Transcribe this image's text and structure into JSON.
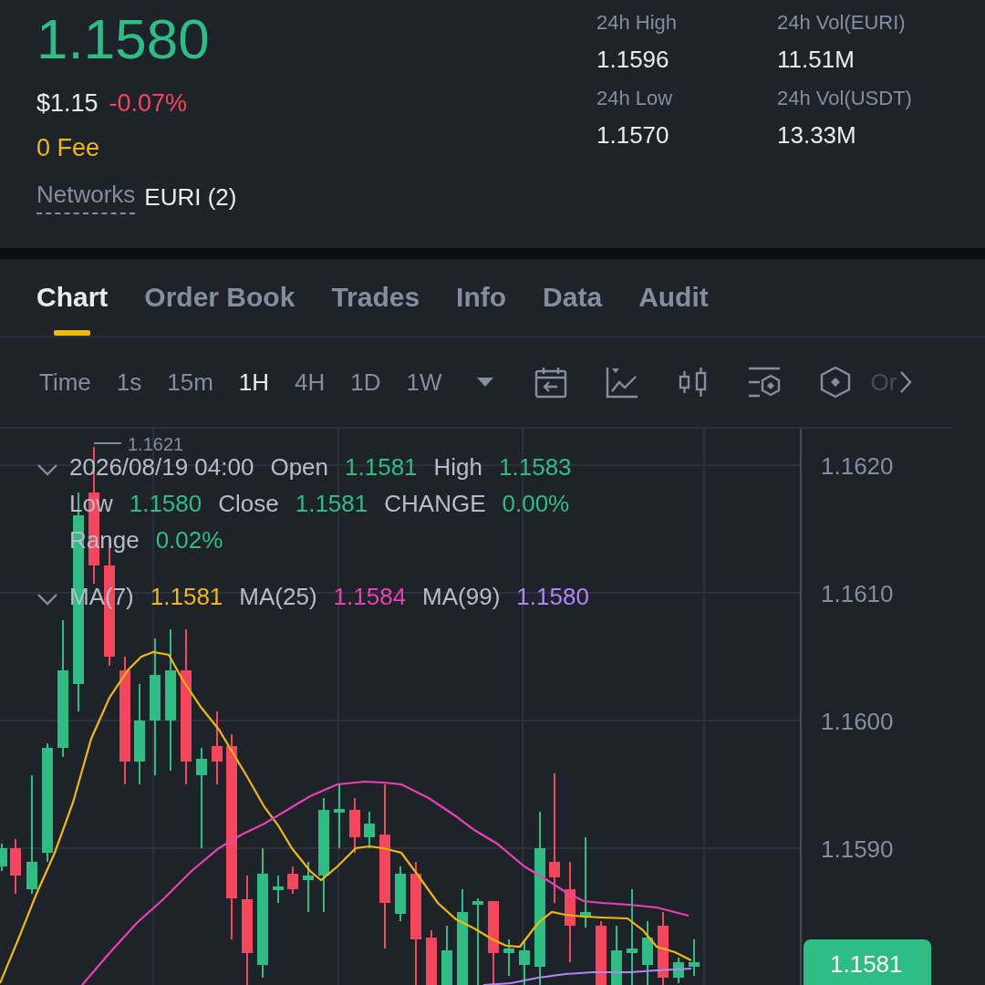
{
  "ticker": {
    "price": "1.1580",
    "usd_price": "$1.15",
    "change": "-0.07%",
    "fee": "0 Fee",
    "networks_label": "Networks",
    "networks_value": "EURI (2)"
  },
  "stats": [
    {
      "label": "24h High",
      "value": "1.1596"
    },
    {
      "label": "24h Vol(EURI)",
      "value": "11.51M"
    },
    {
      "label": "24h Low",
      "value": "1.1570"
    },
    {
      "label": "24h Vol(USDT)",
      "value": "13.33M"
    }
  ],
  "tabs": [
    {
      "label": "Chart",
      "selected": true
    },
    {
      "label": "Order Book",
      "selected": false
    },
    {
      "label": "Trades",
      "selected": false
    },
    {
      "label": "Info",
      "selected": false
    },
    {
      "label": "Data",
      "selected": false
    },
    {
      "label": "Audit",
      "selected": false
    }
  ],
  "toolbar": {
    "intervals": [
      {
        "label": "Time",
        "selected": false
      },
      {
        "label": "1s",
        "selected": false
      },
      {
        "label": "15m",
        "selected": false
      },
      {
        "label": "1H",
        "selected": true
      },
      {
        "label": "4H",
        "selected": false
      },
      {
        "label": "1D",
        "selected": false
      },
      {
        "label": "1W",
        "selected": false
      }
    ],
    "tools": [
      {
        "kind": "calendar"
      },
      {
        "kind": "line"
      },
      {
        "kind": "candle"
      },
      {
        "kind": "layout"
      },
      {
        "kind": "hexagon"
      }
    ],
    "overflow_label": "Or"
  },
  "chart": {
    "legend": {
      "datetime": "2026/08/19 04:00",
      "fields": [
        {
          "label": "Open",
          "value": "1.1581"
        },
        {
          "label": "High",
          "value": "1.1583"
        },
        {
          "label": "Low",
          "value": "1.1580"
        },
        {
          "label": "Close",
          "value": "1.1581"
        },
        {
          "label": "CHANGE",
          "value": "0.00%"
        },
        {
          "label": "Range",
          "value": "0.02%"
        }
      ]
    },
    "ma": [
      {
        "label": "MA(7)",
        "value": "1.1581",
        "color": "#f0b90b"
      },
      {
        "label": "MA(25)",
        "value": "1.1584",
        "color": "#eb40b5"
      },
      {
        "label": "MA(99)",
        "value": "1.1580",
        "color": "#b385f8"
      }
    ],
    "high_label": "1.1621",
    "y_axis": [
      "1.1620",
      "1.1610",
      "1.1600",
      "1.1590"
    ],
    "last_price": "1.1581"
  }
}
